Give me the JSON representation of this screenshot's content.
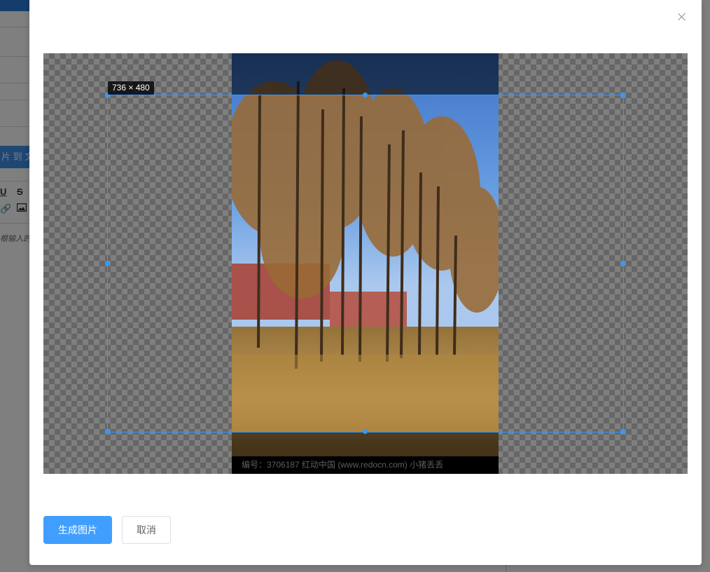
{
  "background_page": {
    "partial_button_label": "片 到 文",
    "toolbar_icons": [
      "underline-icon",
      "strikethrough-icon",
      "link-icon",
      "image-icon"
    ],
    "partial_placeholder": "根输入的"
  },
  "dialog": {
    "close_icon": "close-icon",
    "crop_size_label": "736 × 480",
    "photo_watermark": "编号：3706187    红动中国 (www.redocn.com)    小猪丢丢",
    "generate_button": "生成图片",
    "cancel_button": "取消"
  },
  "colors": {
    "primary": "#409eff",
    "crop_outline": "#3399ff",
    "top_bar": "#2b7ad8"
  }
}
